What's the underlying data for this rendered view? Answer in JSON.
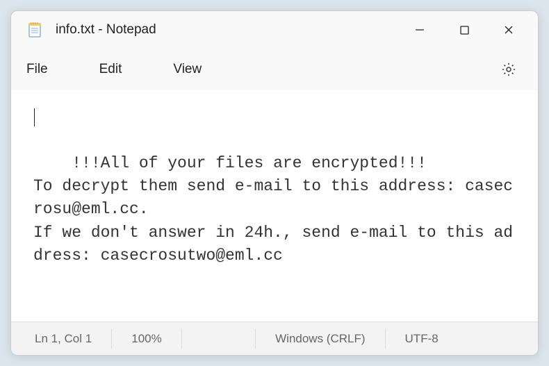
{
  "titlebar": {
    "title": "info.txt - Notepad"
  },
  "menubar": {
    "file": "File",
    "edit": "Edit",
    "view": "View"
  },
  "content": {
    "text": "!!!All of your files are encrypted!!!\nTo decrypt them send e-mail to this address: casecrosu@eml.cc.\nIf we don't answer in 24h., send e-mail to this address: casecrosutwo@eml.cc"
  },
  "statusbar": {
    "position": "Ln 1, Col 1",
    "zoom": "100%",
    "lineending": "Windows (CRLF)",
    "encoding": "UTF-8"
  }
}
